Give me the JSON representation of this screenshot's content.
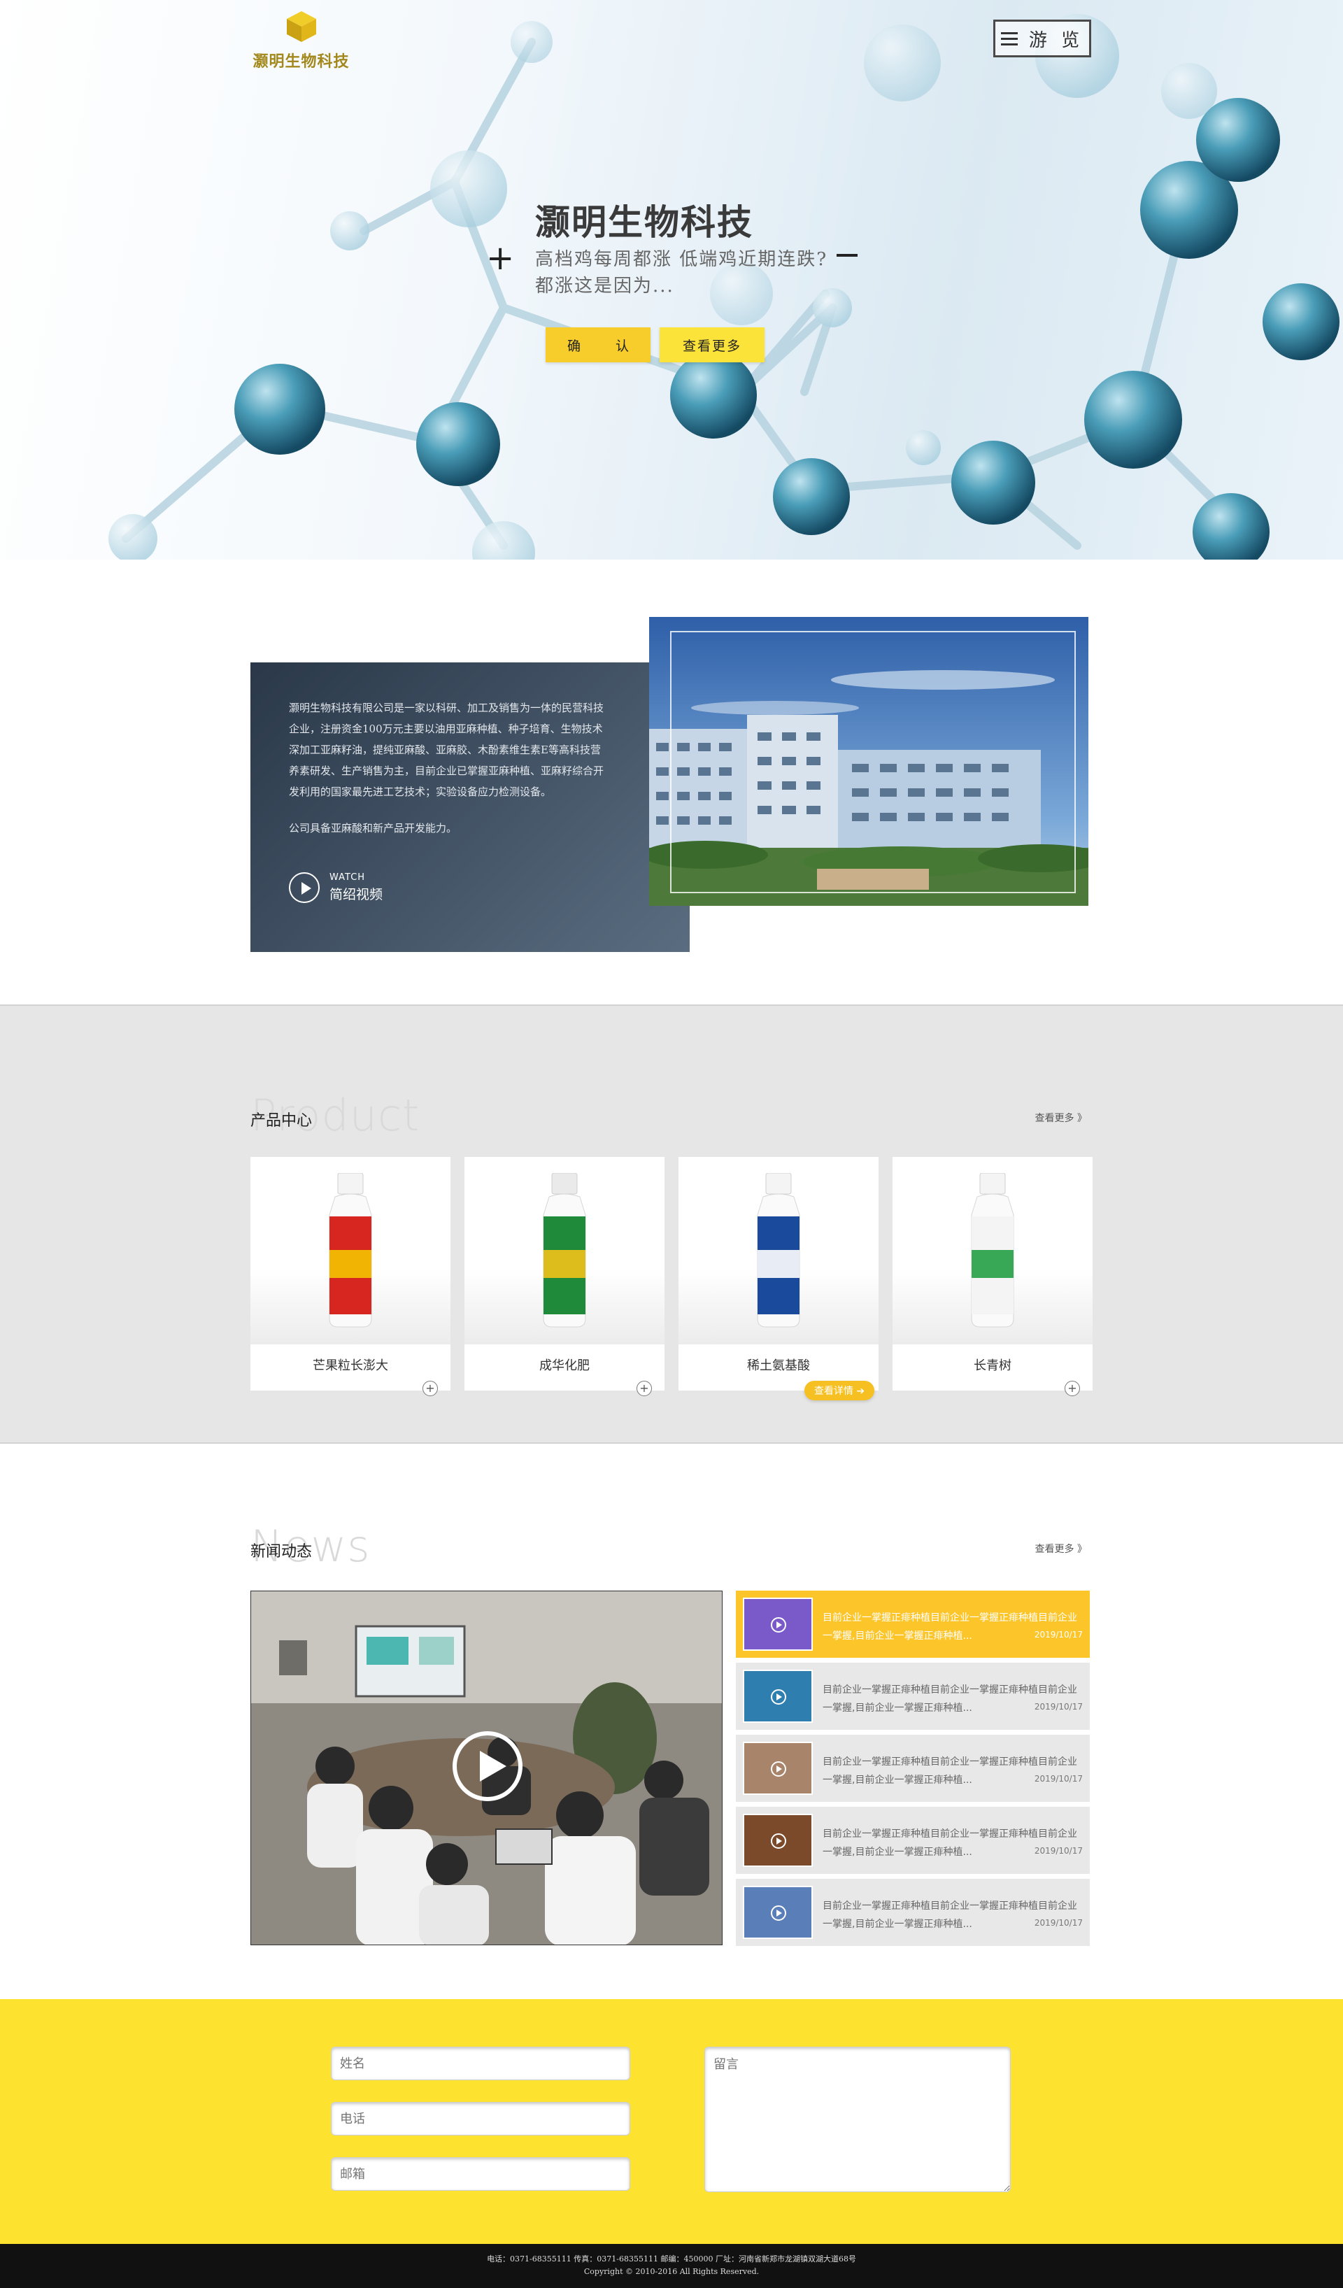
{
  "header": {
    "logo_text": "灏明生物科技",
    "menu_label": "游 览"
  },
  "hero": {
    "title": "灏明生物科技",
    "subtitle": "高档鸡每周都涨 低端鸡近期连跌?都涨这是因为...",
    "plus": "+",
    "confirm_label": "确 认",
    "more_label": "查看更多"
  },
  "about": {
    "paragraph1": "灏明生物科技有限公司是一家以科研、加工及销售为一体的民营科技企业，注册资金100万元主要以油用亚麻种植、种子培育、生物技术深加工亚麻籽油，提纯亚麻酸、亚麻胶、木酚素维生素E等高科技营养素研发、生产销售为主，目前企业已掌握亚麻种植、亚麻籽综合开发利用的国家最先进工艺技术；实验设备应力检测设备。",
    "paragraph2": "公司具备亚麻酸和新产品开发能力。",
    "watch_en": "WATCH",
    "watch_cn": "简绍视频"
  },
  "products": {
    "ghost": "Product",
    "title": "产品中心",
    "more": "查看更多 》",
    "detail_label": "查看详情 ➔",
    "items": [
      {
        "name": "芒果粒长澎大",
        "color": "#d7261f",
        "band": "#f5c400",
        "cap": "#f4f4f4"
      },
      {
        "name": "成华化肥",
        "color": "#1f8a3a",
        "band": "#f2c21a",
        "cap": "#eaeaea"
      },
      {
        "name": "稀土氨基酸",
        "color": "#1a4a9c",
        "band": "#ffffff",
        "cap": "#f4f4f4"
      },
      {
        "name": "长青树",
        "color": "#f4f4f4",
        "band": "#25a045",
        "cap": "#f4f4f4"
      }
    ]
  },
  "news": {
    "ghost": "News",
    "title": "新闻动态",
    "more": "查看更多 》",
    "items": [
      {
        "text": "目前企业一掌握正痱种植目前企业一掌握正痱种植目前企业一掌握,目前企业一掌握正痱种植...",
        "date": "2019/10/17",
        "thumb": "#7a5ac8"
      },
      {
        "text": "目前企业一掌握正痱种植目前企业一掌握正痱种植目前企业一掌握,目前企业一掌握正痱种植...",
        "date": "2019/10/17",
        "thumb": "#2e7fb0"
      },
      {
        "text": "目前企业一掌握正痱种植目前企业一掌握正痱种植目前企业一掌握,目前企业一掌握正痱种植...",
        "date": "2019/10/17",
        "thumb": "#a8846a"
      },
      {
        "text": "目前企业一掌握正痱种植目前企业一掌握正痱种植目前企业一掌握,目前企业一掌握正痱种植...",
        "date": "2019/10/17",
        "thumb": "#7a4a2a"
      },
      {
        "text": "目前企业一掌握正痱种植目前企业一掌握正痱种植目前企业一掌握,目前企业一掌握正痱种植...",
        "date": "2019/10/17",
        "thumb": "#5a7fb8"
      }
    ]
  },
  "contact": {
    "name_placeholder": "姓名",
    "phone_placeholder": "电话",
    "email_placeholder": "邮箱",
    "message_placeholder": "留言"
  },
  "footer": {
    "line1": "电话：0371-68355111  传真：0371-68355111  邮编：450000  厂址：河南省新郑市龙湖镇双湖大道68号",
    "line2": "Copyright © 2010-2016 All Rights Reserved."
  },
  "colors": {
    "accent_yellow": "#fde22f",
    "button_yellow": "#f6cd2a",
    "panel_dark": "#2a3849",
    "products_bg": "#e6e6e6",
    "footer_bg": "#111111"
  }
}
